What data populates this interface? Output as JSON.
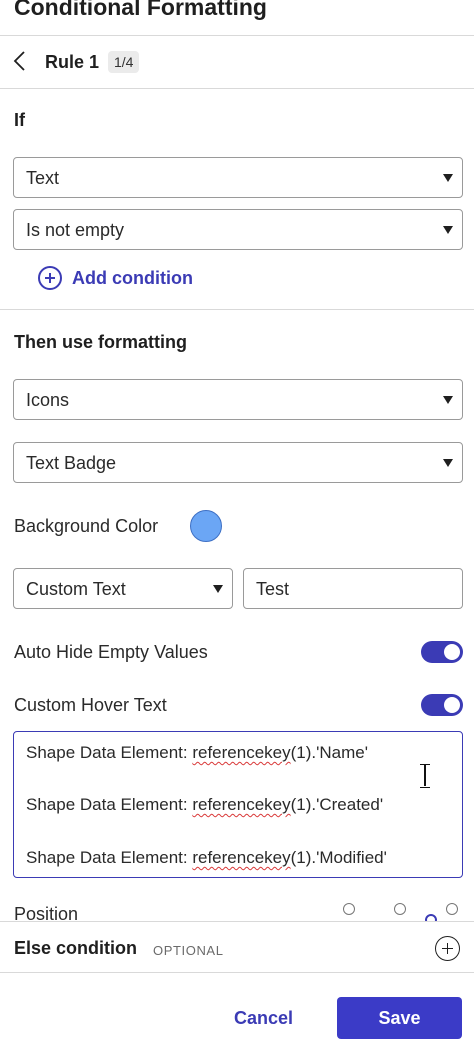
{
  "panel": {
    "title": "Conditional Formatting"
  },
  "rule": {
    "name": "Rule 1",
    "count": "1/4"
  },
  "if_section": {
    "label": "If",
    "field_select": "Text",
    "operator_select": "Is not empty",
    "add_condition_label": "Add condition"
  },
  "then_section": {
    "label": "Then use formatting",
    "format_type_select": "Icons",
    "style_select": "Text Badge",
    "background_color_label": "Background Color",
    "background_color": "#6ba6f5",
    "text_source_select": "Custom Text",
    "custom_text_value": "Test",
    "auto_hide_label": "Auto Hide Empty Values",
    "auto_hide_on": true,
    "hover_text_label": "Custom Hover Text",
    "hover_text_on": true,
    "hover_text_lines": [
      {
        "prefix": "Shape Data Element: ",
        "key": "referencekey",
        "suffix": "(1).'Name'"
      },
      {
        "prefix": "Shape Data Element: ",
        "key": "referencekey",
        "suffix": "(1).'Created'"
      },
      {
        "prefix": "Shape Data Element: ",
        "key": "referencekey",
        "suffix": "(1).'Modified'"
      }
    ],
    "position_label": "Position"
  },
  "else_section": {
    "label": "Else condition",
    "optional_tag": "OPTIONAL"
  },
  "footer": {
    "cancel_label": "Cancel",
    "save_label": "Save"
  },
  "colors": {
    "accent": "#3b3bc7",
    "toggle_on": "#3b3bb5",
    "link": "#3b3bb5"
  }
}
